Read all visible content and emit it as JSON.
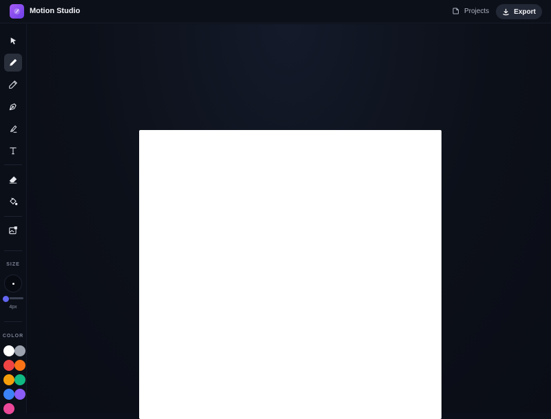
{
  "app": {
    "title": "Motion Studio",
    "logo_icon": "brush-logo-icon",
    "accent_color": "#7c4dff"
  },
  "header": {
    "projects_label": "Projects",
    "projects_icon": "folder-icon",
    "export_label": "Export",
    "export_icon": "download-icon"
  },
  "tools": [
    {
      "name": "select",
      "icon": "cursor-arrow-icon",
      "active": false
    },
    {
      "name": "brush",
      "icon": "brush-icon",
      "active": true
    },
    {
      "name": "pencil",
      "icon": "pencil-icon",
      "active": false
    },
    {
      "name": "pen",
      "icon": "pen-nib-icon",
      "active": false
    },
    {
      "name": "highlighter",
      "icon": "highlighter-icon",
      "active": false
    },
    {
      "name": "text",
      "icon": "text-icon",
      "active": false
    },
    {
      "name": "eraser",
      "icon": "eraser-icon",
      "active": false
    },
    {
      "name": "fill",
      "icon": "paint-bucket-icon",
      "active": false
    },
    {
      "name": "image",
      "icon": "image-icon",
      "active": false
    }
  ],
  "size": {
    "label": "SIZE",
    "value_text": "4px",
    "slider_fraction": 0.05
  },
  "color": {
    "label": "COLOR",
    "swatches": [
      "#ffffff",
      "#9ca3af",
      "#ef4444",
      "#f97316",
      "#f59e0b",
      "#10b981",
      "#3b82f6",
      "#8b5cf6",
      "#ec4899"
    ]
  },
  "canvas": {
    "background": "#ffffff"
  }
}
